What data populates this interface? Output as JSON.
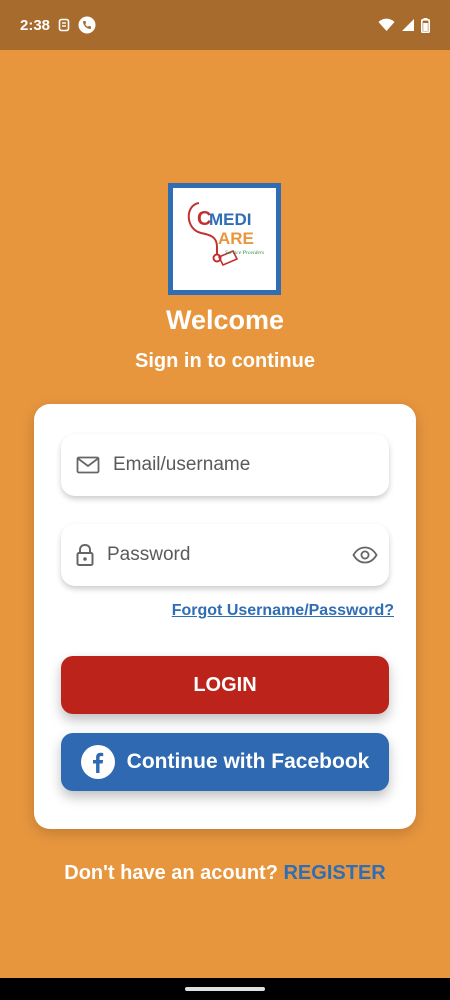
{
  "status_bar": {
    "time": "2:38",
    "icons": [
      "sim-icon",
      "phone-icon",
      "wifi-icon",
      "signal-icon",
      "battery-icon"
    ]
  },
  "logo": {
    "line1_a": "MEDI",
    "line1_b": "C",
    "line2": "ARE",
    "tagline": "Service Providers"
  },
  "welcome": {
    "title": "Welcome",
    "subtitle": "Sign in to continue"
  },
  "form": {
    "email_placeholder": "Email/username",
    "password_placeholder": "Password",
    "forgot_label": "Forgot Username/Password?",
    "login_label": "LOGIN",
    "facebook_label": "Continue with Facebook"
  },
  "footer": {
    "prompt": "Don't have an acount?",
    "register_label": "REGISTER"
  },
  "colors": {
    "background": "#E8963E",
    "status_bar": "#A86B2E",
    "login": "#BC241B",
    "facebook": "#2E69B2",
    "link": "#2F6DB5"
  }
}
